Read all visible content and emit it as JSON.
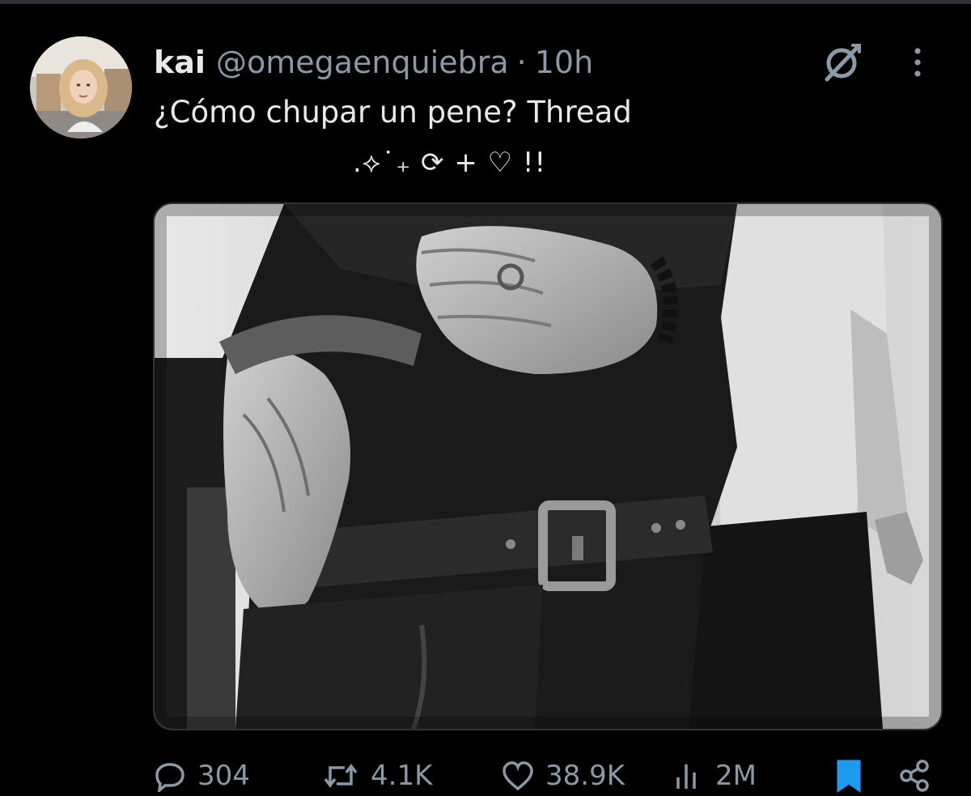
{
  "tweet": {
    "author": {
      "display_name": "kai",
      "handle": "@omegaenquiebra",
      "separator": "·",
      "timestamp": "10h",
      "avatar_icon": "avatar"
    },
    "text": "¿Cómo chupar un pene? Thread",
    "decoration": ".⟡˙₊ ⟳ + ♡ !!",
    "media": {
      "kind": "image",
      "style": "black-and-white photo"
    },
    "actions": {
      "reply_count": "304",
      "retweet_count": "4.1K",
      "like_count": "38.9K",
      "views_count": "2M",
      "bookmark_icon": "bookmark-icon",
      "share_icon": "share-icon"
    },
    "header_icons": [
      "grok-icon",
      "more-icon"
    ]
  },
  "colors": {
    "background": "#000000",
    "text_primary": "#e7e9ea",
    "text_secondary": "#8b98a5",
    "bookmark_accent": "#1d9bf0",
    "divider": "#2f3336"
  }
}
